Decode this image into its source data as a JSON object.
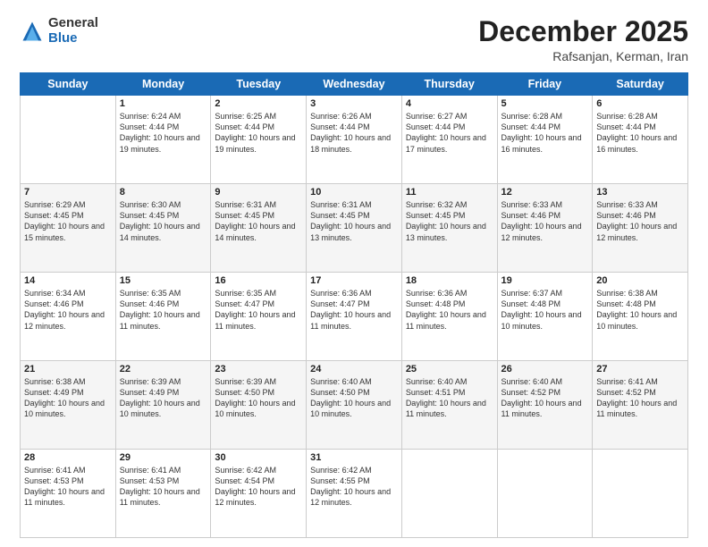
{
  "logo": {
    "general": "General",
    "blue": "Blue"
  },
  "title": "December 2025",
  "location": "Rafsanjan, Kerman, Iran",
  "days_of_week": [
    "Sunday",
    "Monday",
    "Tuesday",
    "Wednesday",
    "Thursday",
    "Friday",
    "Saturday"
  ],
  "weeks": [
    [
      {
        "day": "",
        "info": ""
      },
      {
        "day": "1",
        "info": "Sunrise: 6:24 AM\nSunset: 4:44 PM\nDaylight: 10 hours\nand 19 minutes."
      },
      {
        "day": "2",
        "info": "Sunrise: 6:25 AM\nSunset: 4:44 PM\nDaylight: 10 hours\nand 19 minutes."
      },
      {
        "day": "3",
        "info": "Sunrise: 6:26 AM\nSunset: 4:44 PM\nDaylight: 10 hours\nand 18 minutes."
      },
      {
        "day": "4",
        "info": "Sunrise: 6:27 AM\nSunset: 4:44 PM\nDaylight: 10 hours\nand 17 minutes."
      },
      {
        "day": "5",
        "info": "Sunrise: 6:28 AM\nSunset: 4:44 PM\nDaylight: 10 hours\nand 16 minutes."
      },
      {
        "day": "6",
        "info": "Sunrise: 6:28 AM\nSunset: 4:44 PM\nDaylight: 10 hours\nand 16 minutes."
      }
    ],
    [
      {
        "day": "7",
        "info": "Sunrise: 6:29 AM\nSunset: 4:45 PM\nDaylight: 10 hours\nand 15 minutes."
      },
      {
        "day": "8",
        "info": "Sunrise: 6:30 AM\nSunset: 4:45 PM\nDaylight: 10 hours\nand 14 minutes."
      },
      {
        "day": "9",
        "info": "Sunrise: 6:31 AM\nSunset: 4:45 PM\nDaylight: 10 hours\nand 14 minutes."
      },
      {
        "day": "10",
        "info": "Sunrise: 6:31 AM\nSunset: 4:45 PM\nDaylight: 10 hours\nand 13 minutes."
      },
      {
        "day": "11",
        "info": "Sunrise: 6:32 AM\nSunset: 4:45 PM\nDaylight: 10 hours\nand 13 minutes."
      },
      {
        "day": "12",
        "info": "Sunrise: 6:33 AM\nSunset: 4:46 PM\nDaylight: 10 hours\nand 12 minutes."
      },
      {
        "day": "13",
        "info": "Sunrise: 6:33 AM\nSunset: 4:46 PM\nDaylight: 10 hours\nand 12 minutes."
      }
    ],
    [
      {
        "day": "14",
        "info": "Sunrise: 6:34 AM\nSunset: 4:46 PM\nDaylight: 10 hours\nand 12 minutes."
      },
      {
        "day": "15",
        "info": "Sunrise: 6:35 AM\nSunset: 4:46 PM\nDaylight: 10 hours\nand 11 minutes."
      },
      {
        "day": "16",
        "info": "Sunrise: 6:35 AM\nSunset: 4:47 PM\nDaylight: 10 hours\nand 11 minutes."
      },
      {
        "day": "17",
        "info": "Sunrise: 6:36 AM\nSunset: 4:47 PM\nDaylight: 10 hours\nand 11 minutes."
      },
      {
        "day": "18",
        "info": "Sunrise: 6:36 AM\nSunset: 4:48 PM\nDaylight: 10 hours\nand 11 minutes."
      },
      {
        "day": "19",
        "info": "Sunrise: 6:37 AM\nSunset: 4:48 PM\nDaylight: 10 hours\nand 10 minutes."
      },
      {
        "day": "20",
        "info": "Sunrise: 6:38 AM\nSunset: 4:48 PM\nDaylight: 10 hours\nand 10 minutes."
      }
    ],
    [
      {
        "day": "21",
        "info": "Sunrise: 6:38 AM\nSunset: 4:49 PM\nDaylight: 10 hours\nand 10 minutes."
      },
      {
        "day": "22",
        "info": "Sunrise: 6:39 AM\nSunset: 4:49 PM\nDaylight: 10 hours\nand 10 minutes."
      },
      {
        "day": "23",
        "info": "Sunrise: 6:39 AM\nSunset: 4:50 PM\nDaylight: 10 hours\nand 10 minutes."
      },
      {
        "day": "24",
        "info": "Sunrise: 6:40 AM\nSunset: 4:50 PM\nDaylight: 10 hours\nand 10 minutes."
      },
      {
        "day": "25",
        "info": "Sunrise: 6:40 AM\nSunset: 4:51 PM\nDaylight: 10 hours\nand 11 minutes."
      },
      {
        "day": "26",
        "info": "Sunrise: 6:40 AM\nSunset: 4:52 PM\nDaylight: 10 hours\nand 11 minutes."
      },
      {
        "day": "27",
        "info": "Sunrise: 6:41 AM\nSunset: 4:52 PM\nDaylight: 10 hours\nand 11 minutes."
      }
    ],
    [
      {
        "day": "28",
        "info": "Sunrise: 6:41 AM\nSunset: 4:53 PM\nDaylight: 10 hours\nand 11 minutes."
      },
      {
        "day": "29",
        "info": "Sunrise: 6:41 AM\nSunset: 4:53 PM\nDaylight: 10 hours\nand 11 minutes."
      },
      {
        "day": "30",
        "info": "Sunrise: 6:42 AM\nSunset: 4:54 PM\nDaylight: 10 hours\nand 12 minutes."
      },
      {
        "day": "31",
        "info": "Sunrise: 6:42 AM\nSunset: 4:55 PM\nDaylight: 10 hours\nand 12 minutes."
      },
      {
        "day": "",
        "info": ""
      },
      {
        "day": "",
        "info": ""
      },
      {
        "day": "",
        "info": ""
      }
    ]
  ]
}
